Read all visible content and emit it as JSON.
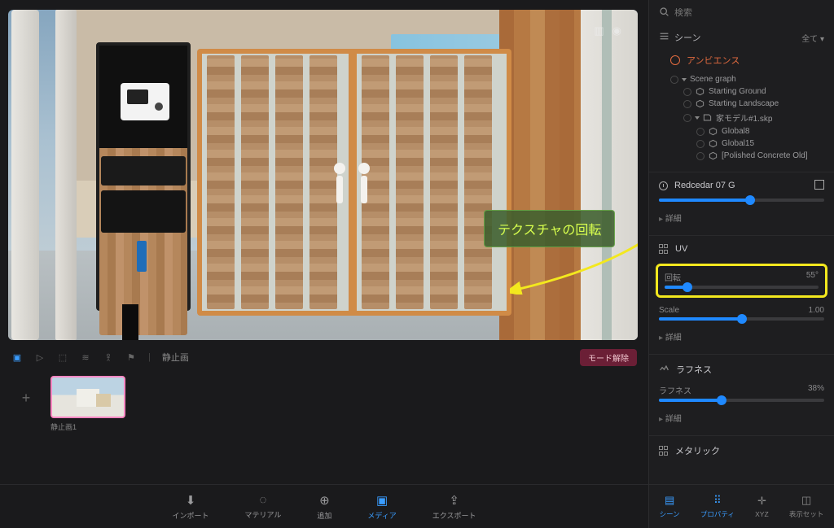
{
  "annotation": {
    "label": "テクスチャの回転"
  },
  "viewport": {
    "under_label": "静止画",
    "mode_pill": "モード解除"
  },
  "media": {
    "thumb1_label": "静止画1"
  },
  "bottom_nav": {
    "import": "インポート",
    "material": "マテリアル",
    "add": "追加",
    "media": "メディア",
    "export": "エクスポート"
  },
  "right": {
    "search_placeholder": "検索",
    "scene_label": "シーン",
    "all_label": "全て",
    "ambience": "アンビエンス",
    "tree": {
      "scene_graph": "Scene graph",
      "starting_ground": "Starting Ground",
      "starting_landscape": "Starting Landscape",
      "house_model": "家モデル#1.skp",
      "global8": "Global8",
      "global15": "Global15",
      "polished": "[Polished Concrete Old]"
    },
    "material_name": "Redcedar 07 G",
    "uv": {
      "title": "UV",
      "rotation_label": "回転",
      "rotation_value": "55°",
      "scale_label": "Scale",
      "scale_value": "1.00"
    },
    "roughness": {
      "title": "ラフネス",
      "label": "ラフネス",
      "value": "38%"
    },
    "metallic": {
      "title": "メタリック"
    },
    "detail": "詳細"
  },
  "right_nav": {
    "scene": "シーン",
    "property": "プロパティ",
    "xyz": "XYZ",
    "display_set": "表示セット"
  }
}
